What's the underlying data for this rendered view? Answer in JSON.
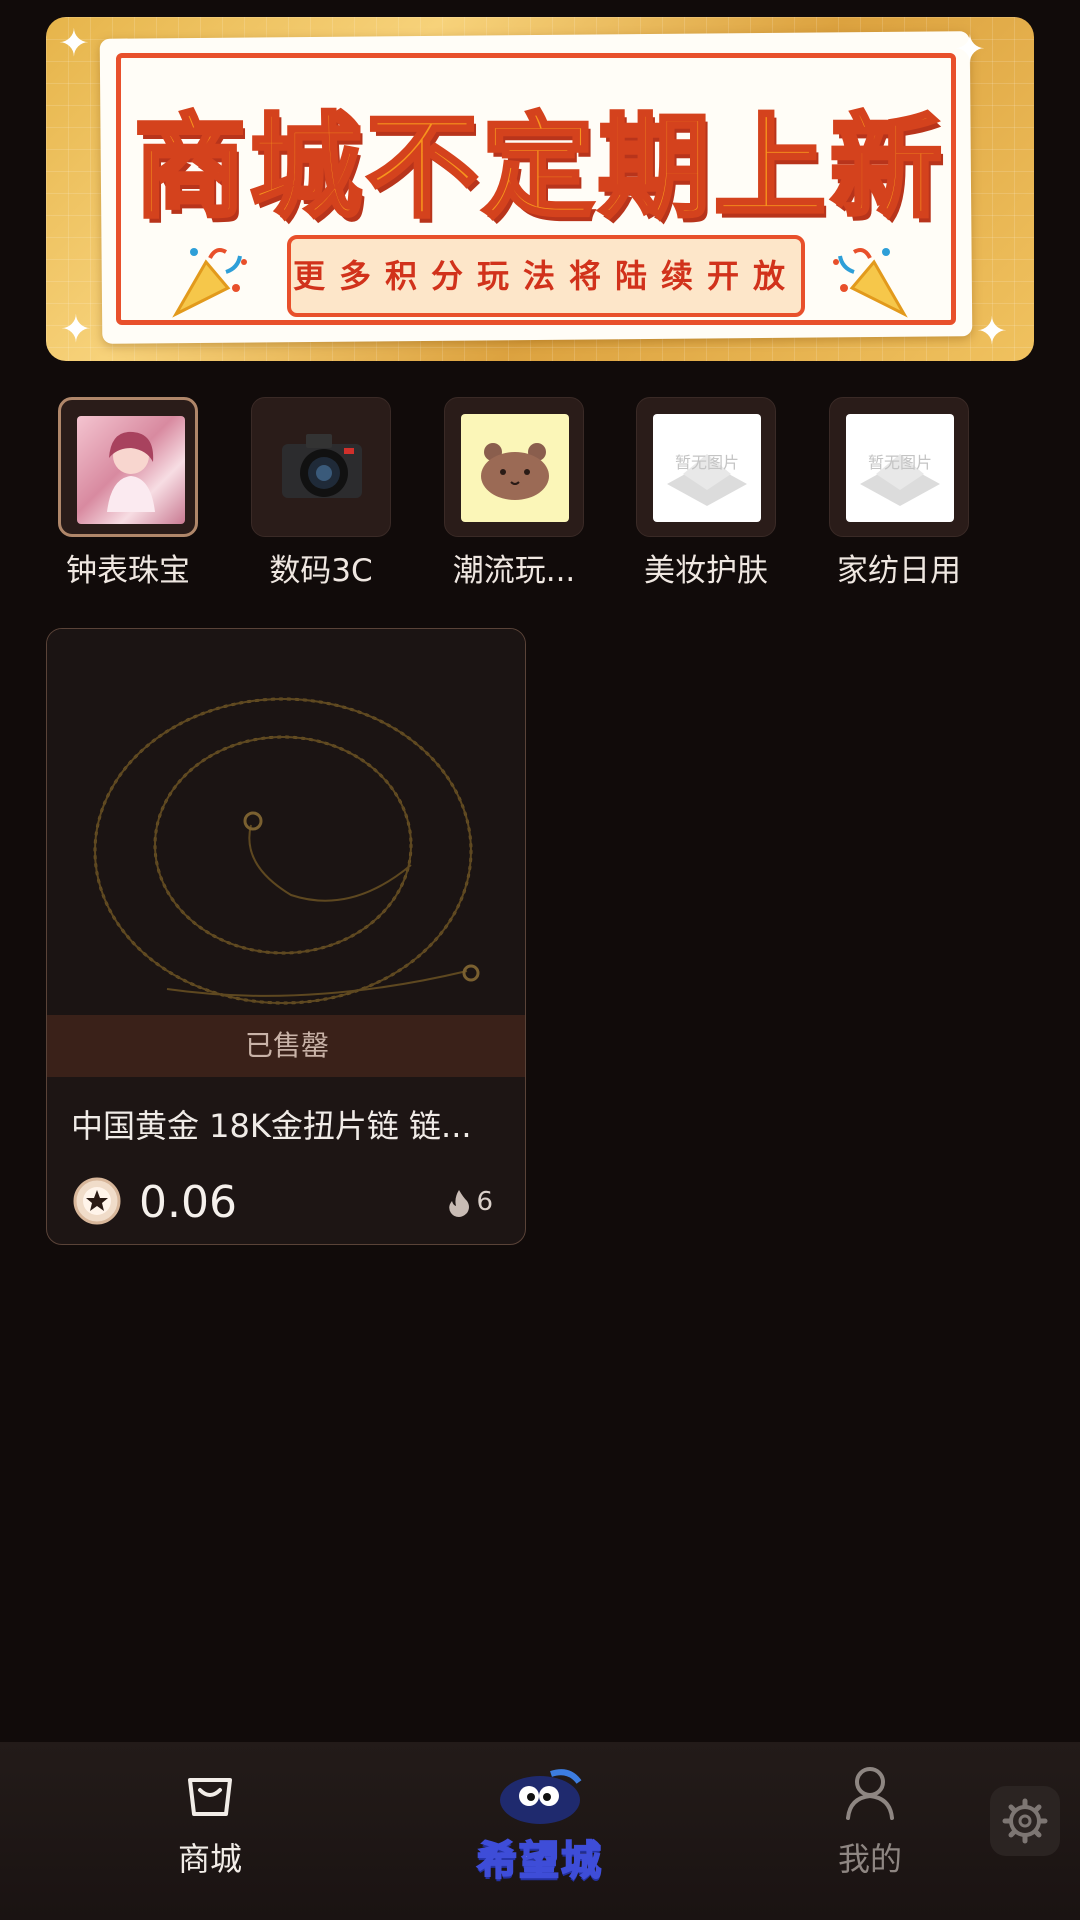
{
  "banner": {
    "title": "商城不定期上新",
    "subtitle": "更多积分玩法将陆续开放"
  },
  "categories": [
    {
      "label": "钟表珠宝",
      "active": true
    },
    {
      "label": "数码3C",
      "active": false
    },
    {
      "label": "潮流玩...",
      "active": false
    },
    {
      "label": "美妆护肤",
      "active": false,
      "placeholder": "暂无图片"
    },
    {
      "label": "家纺日用",
      "active": false,
      "placeholder": "暂无图片"
    }
  ],
  "product": {
    "status": "已售罄",
    "name": "中国黄金 18K金扭片链 链...",
    "price": "0.06",
    "heat": "6"
  },
  "nav": {
    "shop_label": "商城",
    "center_logo": "希望城",
    "mine_label": "我的"
  },
  "colors": {
    "background": "#110b0a",
    "accent_orange": "#e8502b",
    "banner_gold": "#e6b44a",
    "sold_bar": "#3a2119"
  }
}
